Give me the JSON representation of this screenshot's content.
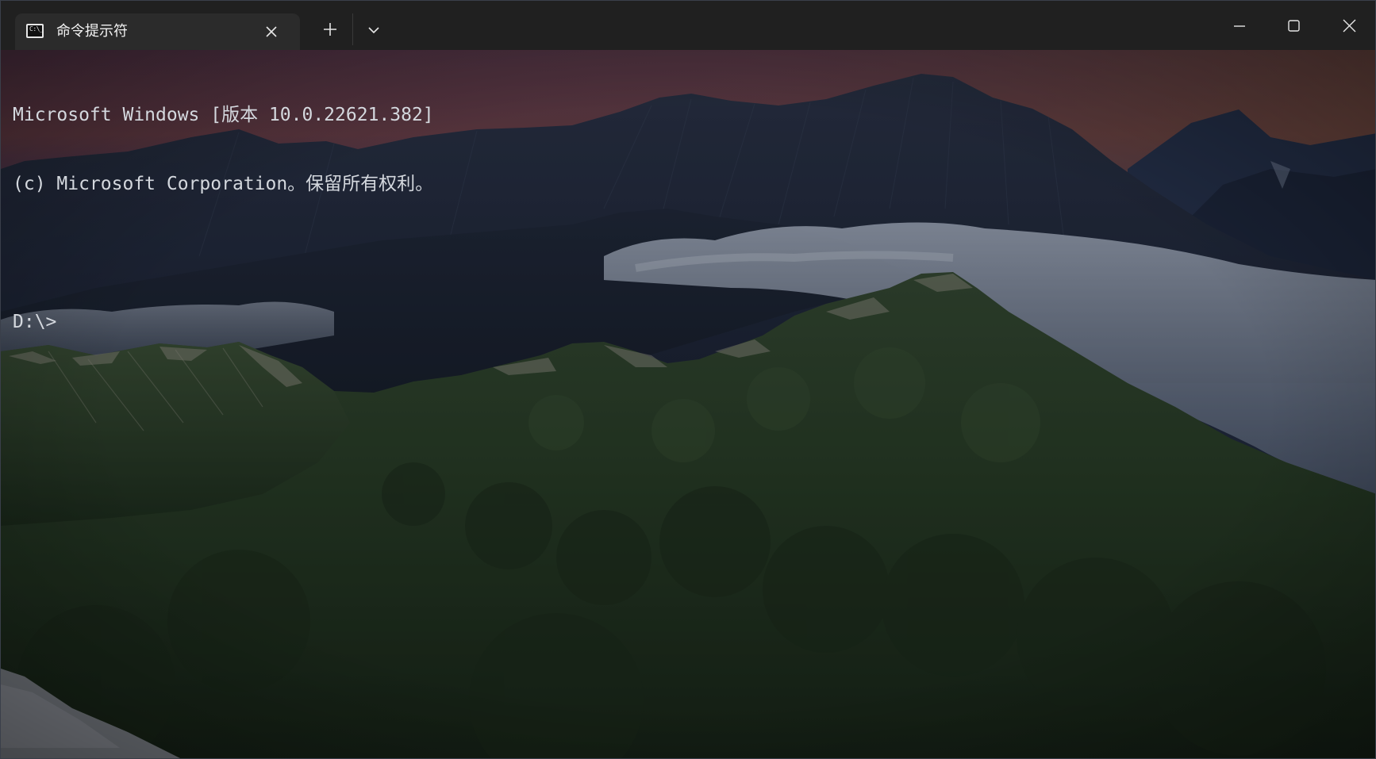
{
  "window": {
    "tab": {
      "icon": "command-prompt-icon",
      "icon_glyph": "C:\\_",
      "title": "命令提示符",
      "close_icon": "close-icon"
    },
    "new_tab_icon": "plus-icon",
    "dropdown_icon": "chevron-down-icon",
    "controls": {
      "minimize_icon": "minimize-icon",
      "maximize_icon": "maximize-icon",
      "close_icon": "close-icon"
    }
  },
  "terminal": {
    "lines": [
      "Microsoft Windows [版本 10.0.22621.382]",
      "(c) Microsoft Corporation。保留所有权利。",
      "",
      "D:\\>"
    ],
    "text_color": "#d4d8de",
    "background_image": "mountain-landscape"
  },
  "colors": {
    "titlebar": "#202020",
    "active_tab": "#2b2b2b",
    "sky_top": "#6b3b4a",
    "mountain_green": "#2a3d21",
    "fog": "#a9b3c2"
  }
}
